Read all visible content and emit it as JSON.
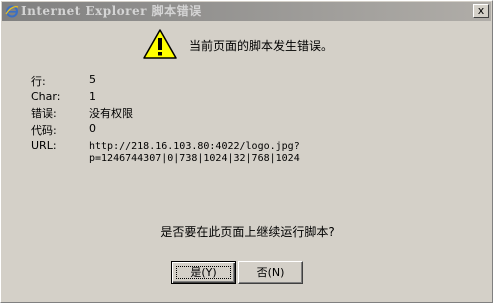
{
  "window": {
    "title": "Internet Explorer 脚本错误",
    "close_symbol": "x"
  },
  "message": "当前页面的脚本发生错误。",
  "details": {
    "line": {
      "label": "行:",
      "value": "5"
    },
    "char": {
      "label": "Char:",
      "value": "1"
    },
    "error": {
      "label": "错误:",
      "value": "没有权限"
    },
    "code": {
      "label": "代码:",
      "value": "0"
    },
    "url": {
      "label": "URL:",
      "value_line1": "http://218.16.103.80:4022/logo.jpg?",
      "value_line2": "p=1246744307|0|738|1024|32|768|1024"
    }
  },
  "question": "是否要在此页面上继续运行脚本?",
  "buttons": {
    "yes_label": "是(Y)",
    "no_label": "否(N)"
  },
  "colors": {
    "dialog_bg": "#d4d0c8",
    "titlebar_inactive": "#808080",
    "warning_yellow": "#ffff00"
  },
  "icons": {
    "title": "ie-icon",
    "message": "warning-icon"
  }
}
